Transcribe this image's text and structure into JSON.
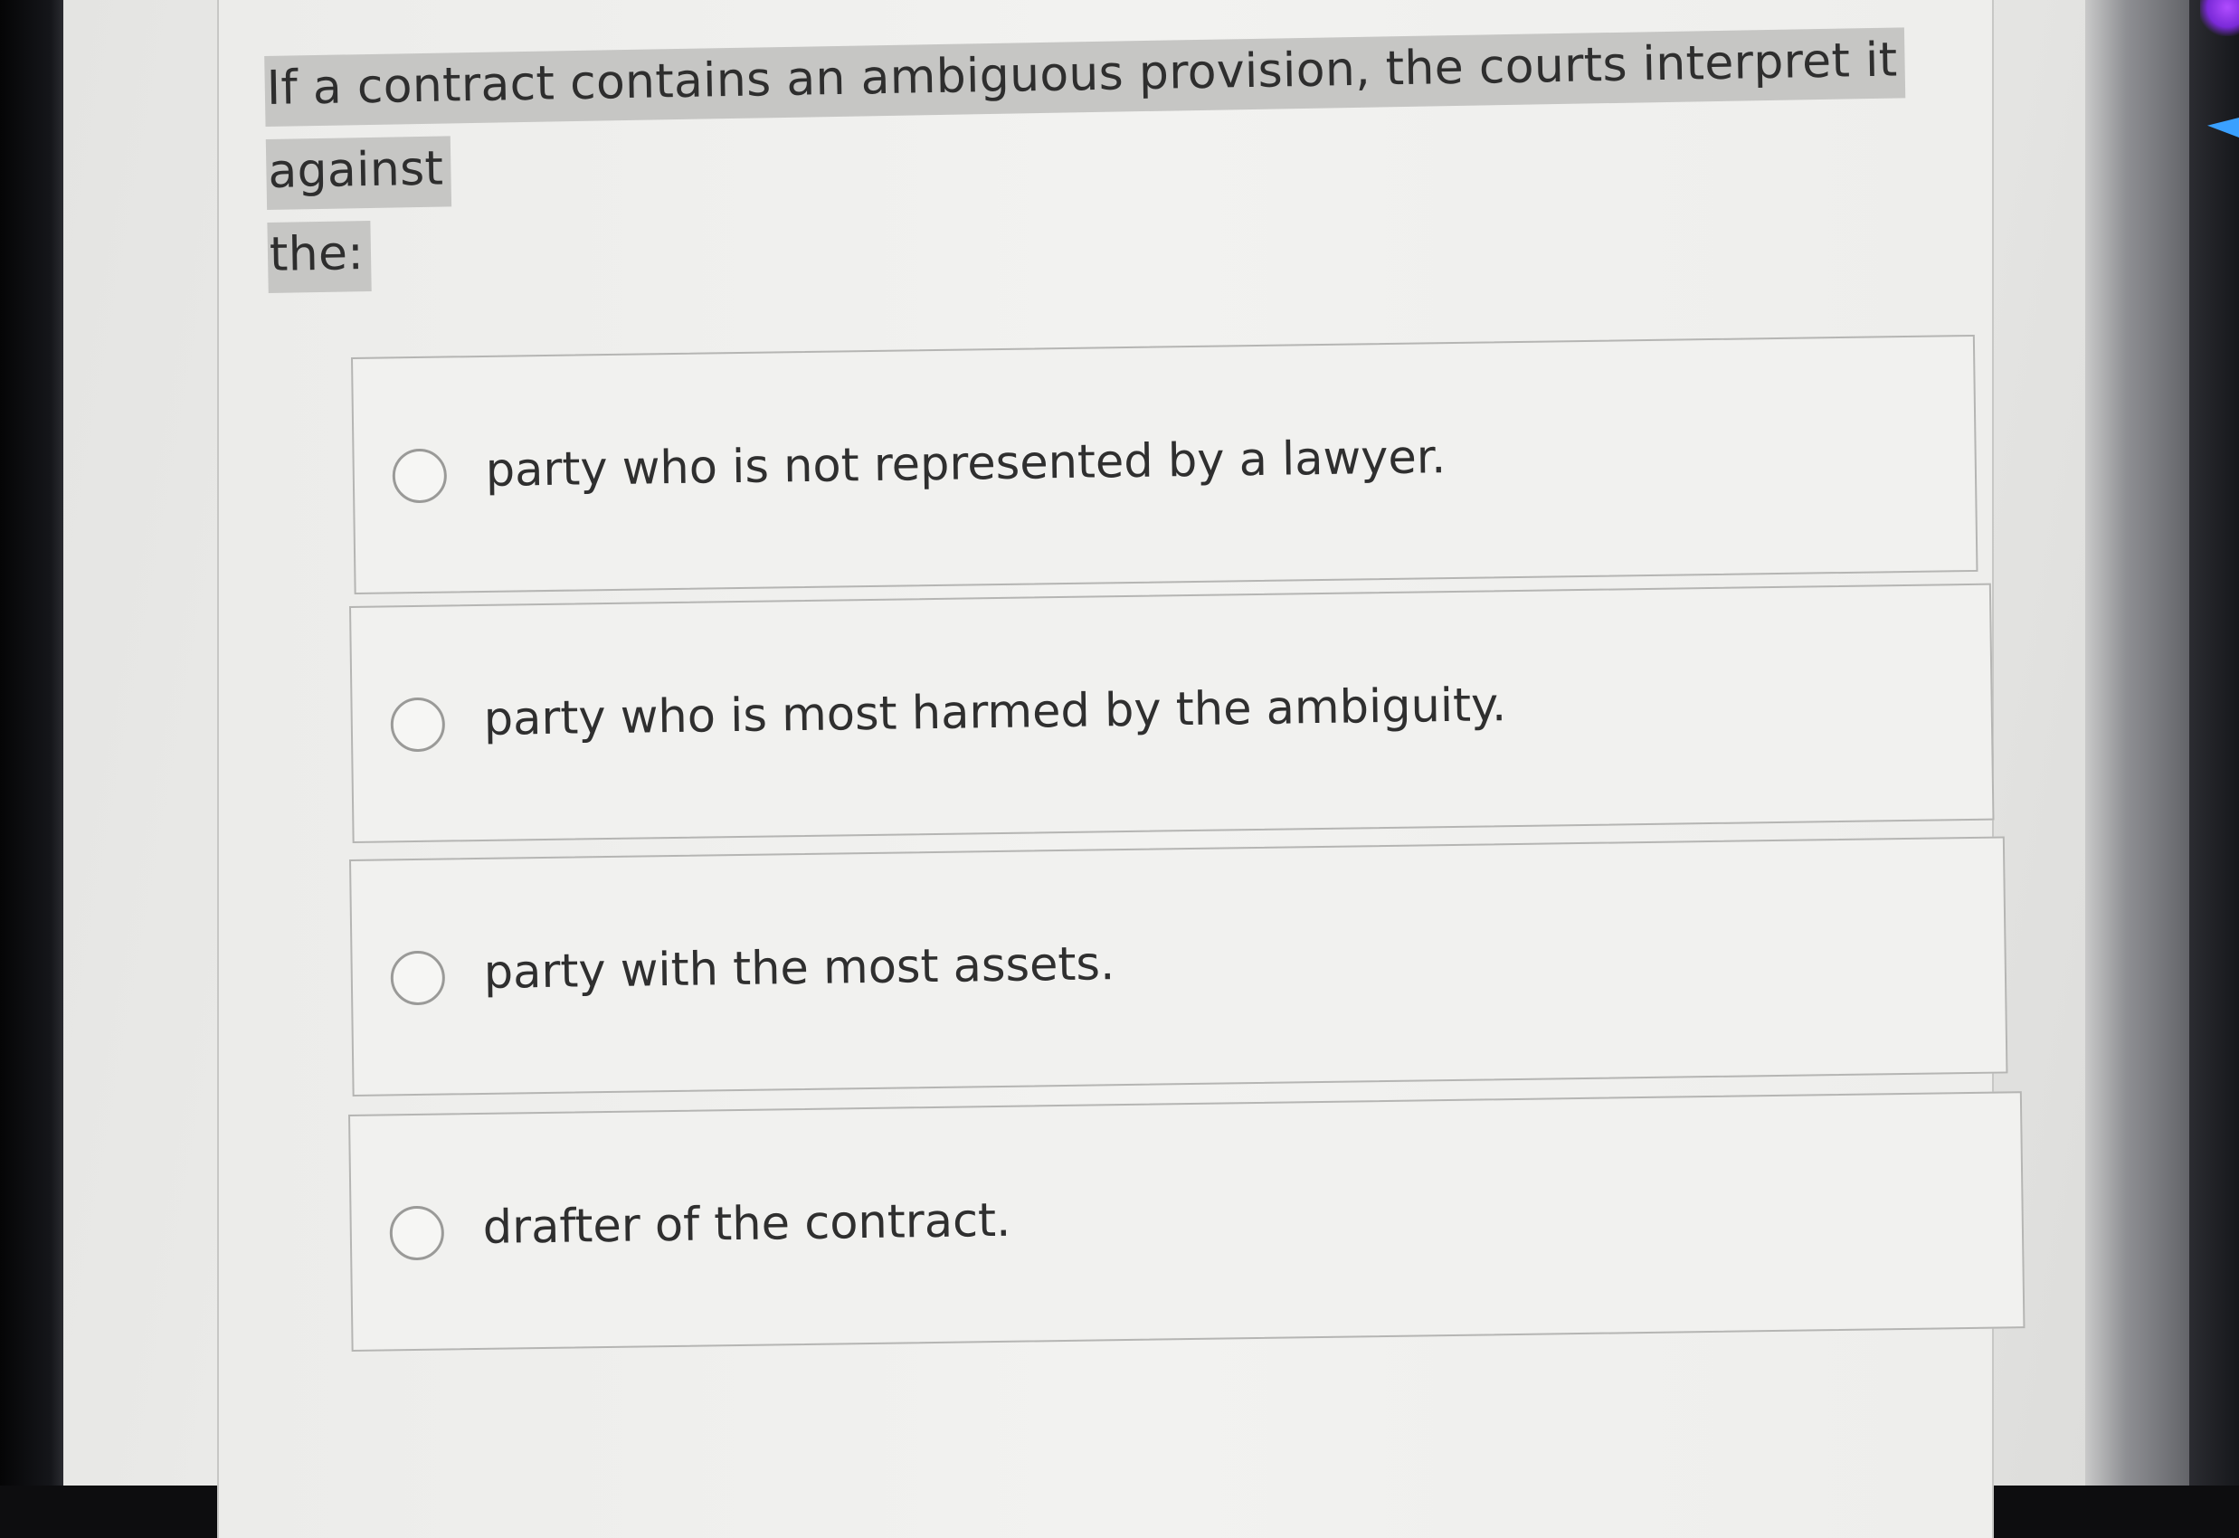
{
  "question": {
    "line1": "If a contract contains an ambiguous provision, the courts interpret it against",
    "line2": "the:"
  },
  "options": [
    {
      "label": "party who is not represented by a lawyer."
    },
    {
      "label": "party who is most harmed by the ambiguity."
    },
    {
      "label": "party with the most assets."
    },
    {
      "label": "drafter of the contract."
    }
  ],
  "selected_option": null,
  "icons": {
    "radio": "radio-unselected-icon"
  }
}
